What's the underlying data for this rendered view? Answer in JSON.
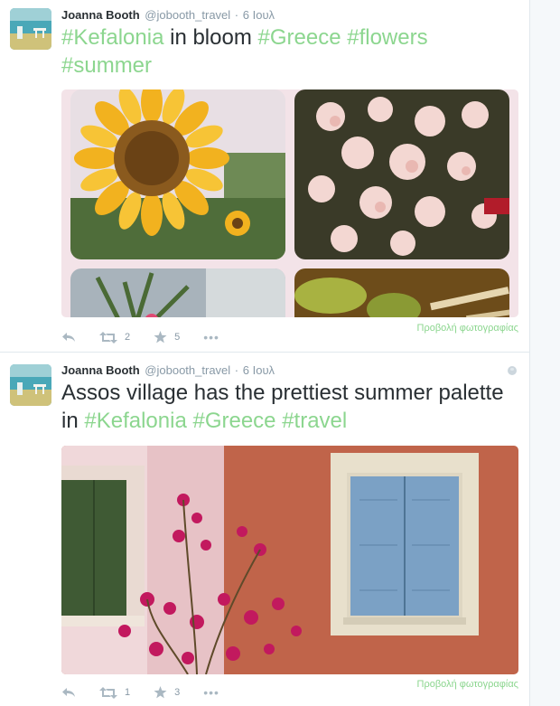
{
  "tweets": [
    {
      "author": {
        "fullname": "Joanna Booth",
        "username": "@jobooth_travel",
        "time": "6 Ιουλ"
      },
      "text_plain_1": "",
      "hashtag_1": "#Kefalonia",
      "text_plain_2": " in bloom ",
      "hashtag_2": "#Greece",
      "hashtag_3": "#flowers",
      "hashtag_4": "#summer",
      "retweets": "2",
      "favorites": "5",
      "view_photo": "Προβολή φωτογραφίας"
    },
    {
      "author": {
        "fullname": "Joanna Booth",
        "username": "@jobooth_travel",
        "time": "6 Ιουλ"
      },
      "text_plain_1": "Assos village has the prettiest summer palette in ",
      "hashtag_1": "#Kefalonia",
      "hashtag_2": "#Greece",
      "hashtag_3": "#travel",
      "retweets": "1",
      "favorites": "3",
      "view_photo": "Προβολή φωτογραφίας"
    }
  ],
  "icons": {
    "reply": "reply-icon",
    "retweet": "retweet-icon",
    "favorite": "star-icon",
    "more": "more-icon",
    "globe": "globe-icon"
  },
  "colors": {
    "hashtag": "#8cd68f",
    "meta": "#8899a6",
    "border": "#e1e8ed"
  }
}
